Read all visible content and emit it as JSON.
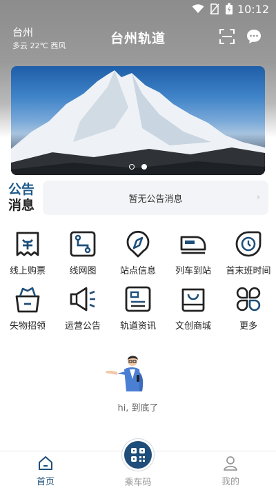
{
  "status_bar": {
    "time": "10:12"
  },
  "header": {
    "city": "台州",
    "weather": "多云 22℃ 西风",
    "title": "台州轨道",
    "scan_icon": "scan-icon",
    "message_icon": "message-icon"
  },
  "banner": {
    "page_count": 2,
    "active_index": 1
  },
  "notice": {
    "label_line1": "公告",
    "label_line2": "消息",
    "message": "暂无公告消息",
    "arrow": "›"
  },
  "menu": {
    "items": [
      {
        "label": "线上购票",
        "icon": "ticket-icon"
      },
      {
        "label": "线网图",
        "icon": "network-map-icon"
      },
      {
        "label": "站点信息",
        "icon": "compass-icon"
      },
      {
        "label": "列车到站",
        "icon": "train-icon"
      },
      {
        "label": "首末班时间",
        "icon": "clock-icon"
      },
      {
        "label": "失物招领",
        "icon": "lost-found-icon"
      },
      {
        "label": "运营公告",
        "icon": "megaphone-icon"
      },
      {
        "label": "轨道资讯",
        "icon": "news-icon"
      },
      {
        "label": "文创商城",
        "icon": "shop-icon"
      },
      {
        "label": "更多",
        "icon": "more-icon"
      }
    ]
  },
  "footer_note": "hi, 到底了",
  "bottom_nav": {
    "home": "首页",
    "ride_code": "乘车码",
    "me": "我的"
  },
  "colors": {
    "primary": "#1e4e79",
    "notice_accent": "#1e5a8a",
    "notice_bg": "#f3f4f7"
  }
}
